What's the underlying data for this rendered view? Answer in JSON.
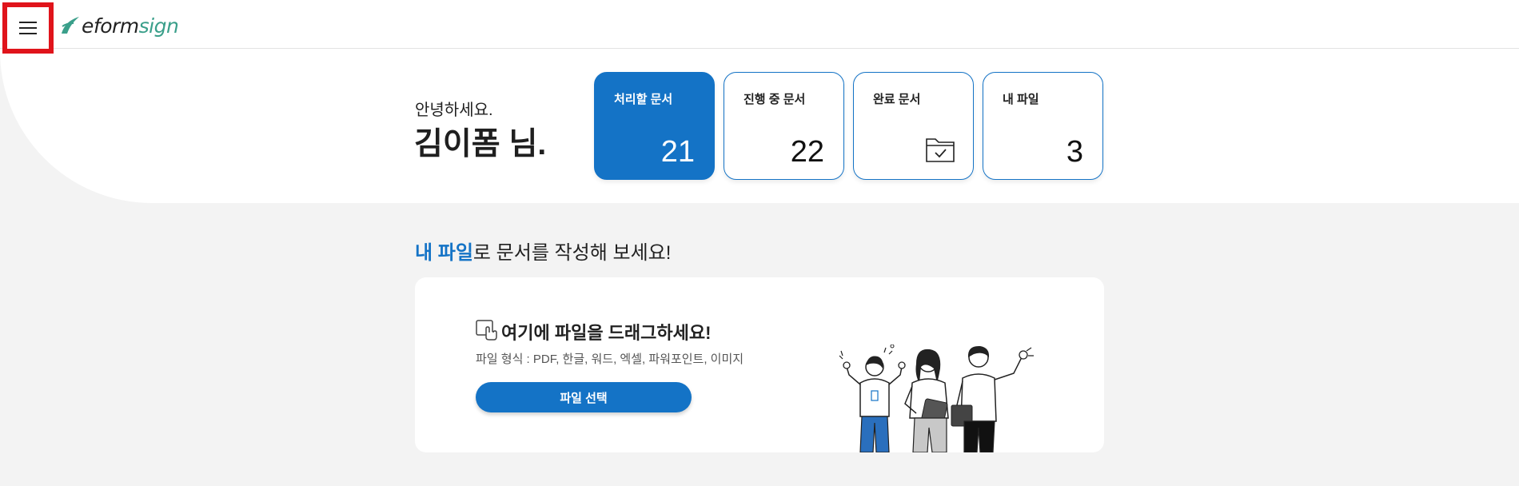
{
  "header": {
    "logo_text_e": "e",
    "logo_text_form": "form",
    "logo_text_sign": "sign",
    "menu_icon": "hamburger-menu-icon"
  },
  "greeting": {
    "hello": "안녕하세요.",
    "name": "김이폼 님."
  },
  "cards": [
    {
      "label": "처리할 문서",
      "count": "21",
      "active": true
    },
    {
      "label": "진행 중 문서",
      "count": "22",
      "active": false
    },
    {
      "label": "완료 문서",
      "icon": "folder-check-icon",
      "active": false
    },
    {
      "label": "내 파일",
      "count": "3",
      "active": false
    }
  ],
  "upload": {
    "section_title_highlight": "내 파일",
    "section_title_rest": "로 문서를 작성해 보세요!",
    "drop_title": "여기에 파일을 드래그하세요!",
    "file_types": "파일 형식 : PDF, 한글, 워드, 엑셀, 파워포인트, 이미지",
    "select_button": "파일 선택",
    "drop_icon": "drag-file-icon",
    "illustration": "team-people-illustration"
  },
  "colors": {
    "accent": "#1473c6",
    "brand_green": "#3a9f8a",
    "page_bg": "#f3f3f3",
    "highlight_border": "#e0141b"
  }
}
